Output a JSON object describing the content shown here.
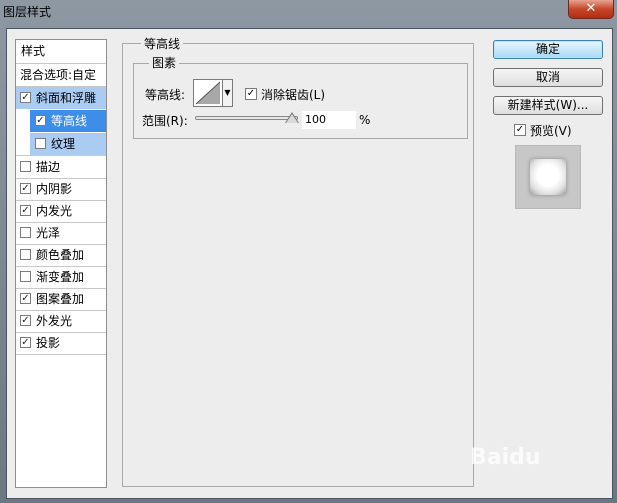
{
  "window": {
    "title": "图层样式",
    "close_glyph": "✕"
  },
  "left_panel": {
    "header": "样式",
    "blend_options": "混合选项:自定",
    "items": [
      {
        "label": "斜面和浮雕",
        "checked": true
      },
      {
        "label": "等高线",
        "checked": true
      },
      {
        "label": "纹理",
        "checked": false
      },
      {
        "label": "描边",
        "checked": false
      },
      {
        "label": "内阴影",
        "checked": true
      },
      {
        "label": "内发光",
        "checked": true
      },
      {
        "label": "光泽",
        "checked": false
      },
      {
        "label": "颜色叠加",
        "checked": false
      },
      {
        "label": "渐变叠加",
        "checked": false
      },
      {
        "label": "图案叠加",
        "checked": true
      },
      {
        "label": "外发光",
        "checked": true
      },
      {
        "label": "投影",
        "checked": true
      }
    ]
  },
  "contour_section": {
    "title": "等高线",
    "group_title": "图素",
    "contour_label": "等高线:",
    "antialias_label": "消除锯齿(L)",
    "antialias_checked": true,
    "range_label": "范围(R):",
    "range_value": "100",
    "range_unit": "%"
  },
  "buttons": {
    "ok": "确定",
    "cancel": "取消",
    "new_style": "新建样式(W)...",
    "preview_label": "预览(V)",
    "preview_checked": true
  },
  "check_glyph": "✓",
  "watermark": "Baidu"
}
